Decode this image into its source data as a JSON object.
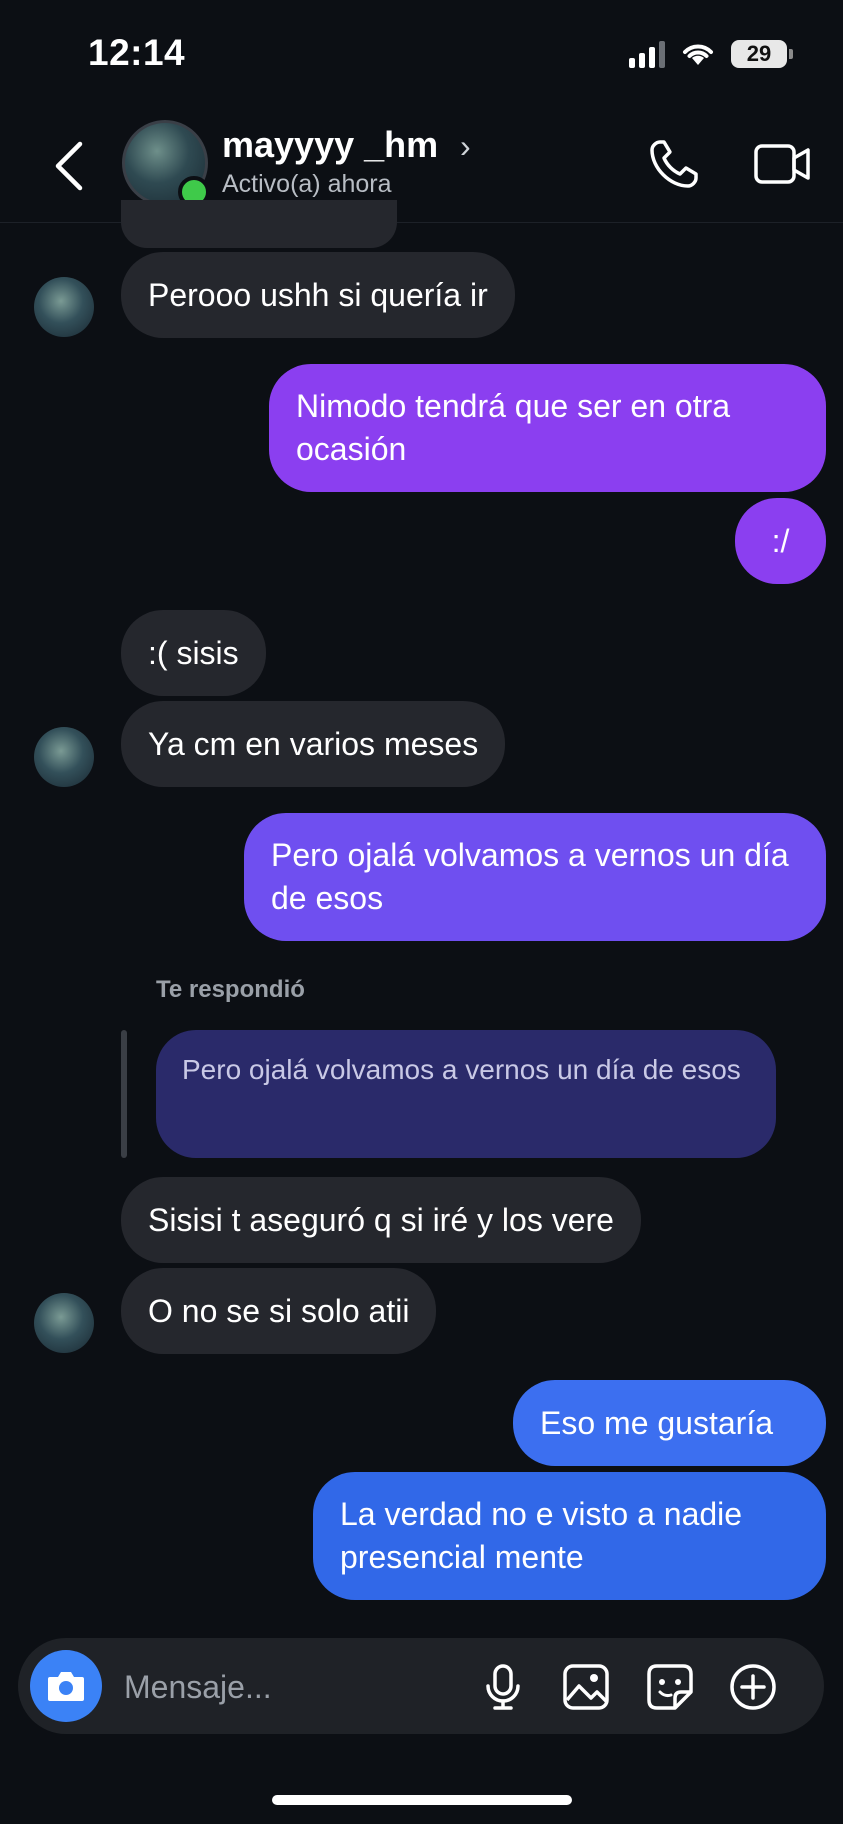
{
  "status_bar": {
    "time": "12:14",
    "battery": "29"
  },
  "header": {
    "name": "mayyyy _hm",
    "status": "Activo(a) ahora",
    "online_color": "#3fca4a"
  },
  "messages": [
    {
      "side": "in",
      "text": "Perooo ushh si quería ir"
    },
    {
      "side": "out",
      "text": "Nimodo tendrá que ser en otra ocasión",
      "color": "#8b3ff0"
    },
    {
      "side": "out",
      "text": ":/",
      "color": "#8b3ff0"
    },
    {
      "side": "in",
      "text": ":( sisis"
    },
    {
      "side": "in",
      "text": "Ya cm en varios meses"
    },
    {
      "side": "out",
      "text": "Pero ojalá volvamos a vernos un día de esos",
      "color": "#6f4ff0"
    },
    {
      "side": "in",
      "text": "Sisisi t aseguró q si iré y los vere"
    },
    {
      "side": "in",
      "text": "O no se si solo atii"
    },
    {
      "side": "out",
      "text": "Eso me gustaría",
      "color": "#3c6ff0"
    },
    {
      "side": "out",
      "text": "La verdad no e visto a nadie presencial mente",
      "color": "#3168e8"
    }
  ],
  "reply": {
    "label": "Te respondió",
    "quoted_text": "Pero ojalá volvamos a vernos un día de esos"
  },
  "composer": {
    "placeholder": "Mensaje...",
    "icons": [
      "camera-icon",
      "microphone-icon",
      "gallery-icon",
      "sticker-icon",
      "plus-icon"
    ]
  }
}
